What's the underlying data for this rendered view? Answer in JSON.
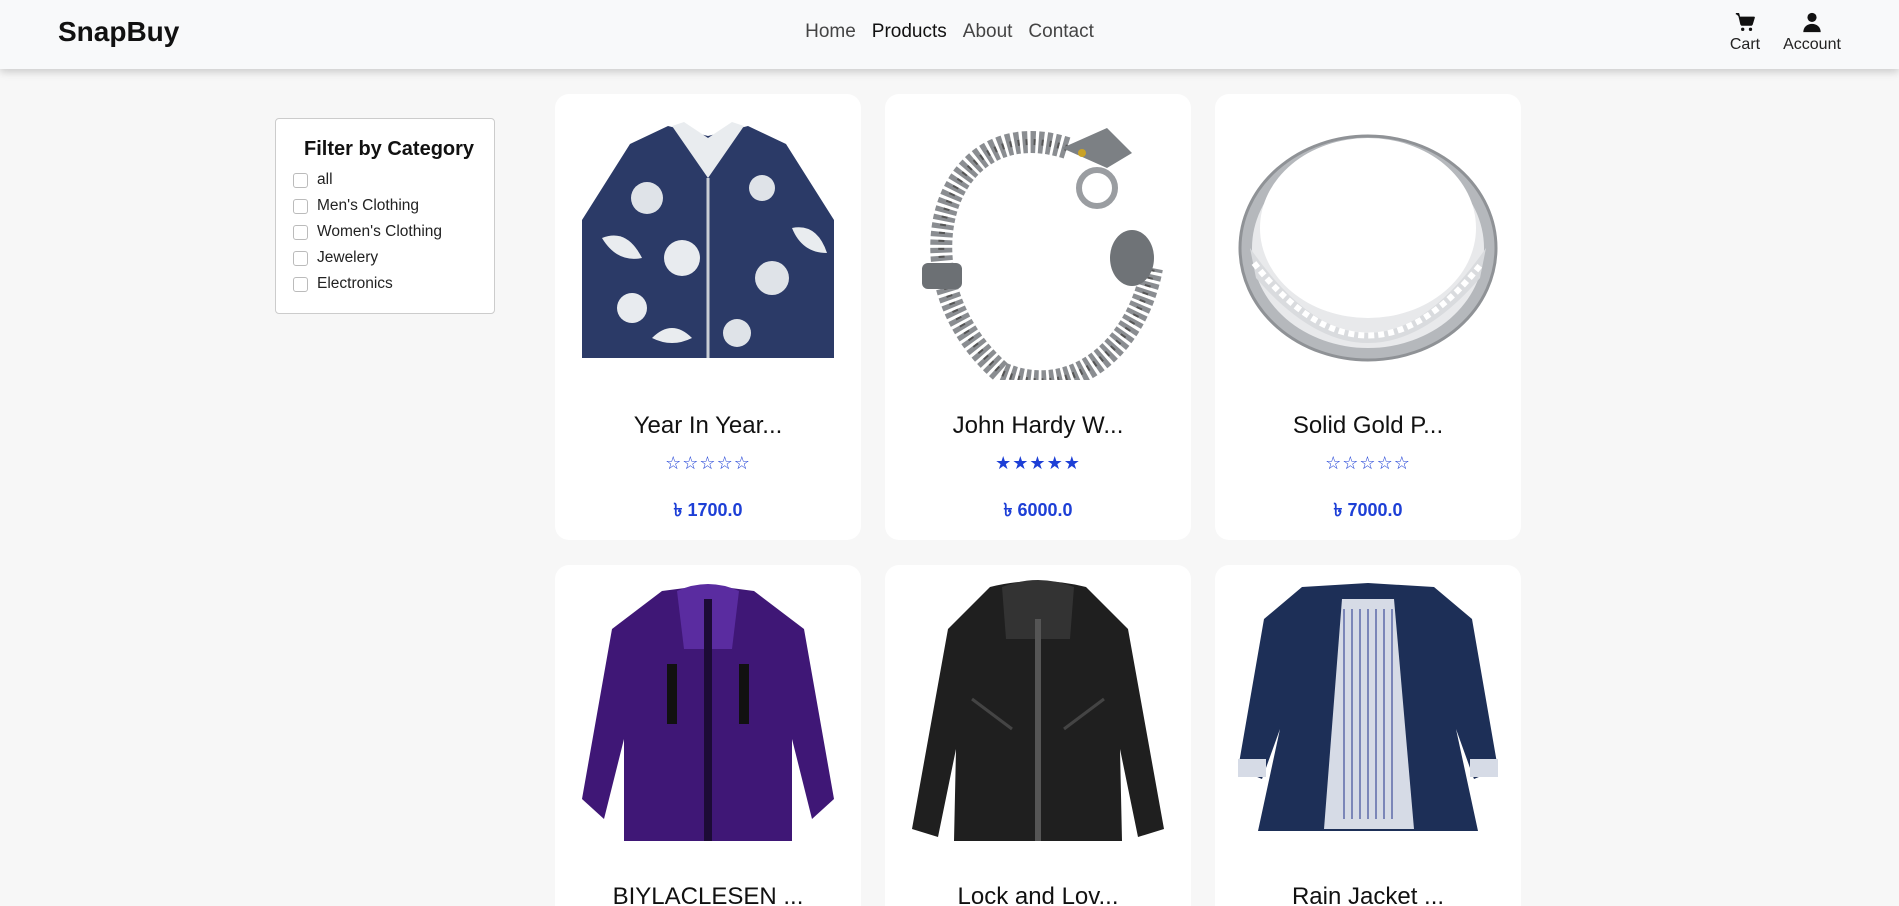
{
  "brand": "SnapBuy",
  "nav": {
    "links": [
      "Home",
      "Products",
      "About",
      "Contact"
    ],
    "cart_label": "Cart",
    "account_label": "Account"
  },
  "filter": {
    "title": "Filter by Category",
    "options": [
      "all",
      "Men's Clothing",
      "Women's Clothing",
      "Jewelery",
      "Electronics"
    ]
  },
  "products": [
    {
      "title": "Year In Year...",
      "stars": "☆☆☆☆☆",
      "price": "৳ 1700.0",
      "image": "floral-shirt"
    },
    {
      "title": "John Hardy W...",
      "stars": "★★★★★",
      "price": "৳ 6000.0",
      "image": "dragon-bracelet"
    },
    {
      "title": "Solid Gold P...",
      "stars": "☆☆☆☆☆",
      "price": "৳ 7000.0",
      "image": "silver-ring"
    },
    {
      "title": "BIYLACLESEN ...",
      "image": "purple-jacket"
    },
    {
      "title": "Lock and Lov...",
      "image": "black-leather-jacket"
    },
    {
      "title": "Rain Jacket ...",
      "image": "navy-rain-jacket"
    }
  ],
  "colors": {
    "accent": "#1d3fd6",
    "navbar_bg": "#f8f9fa",
    "page_bg": "#f7f7f7"
  }
}
